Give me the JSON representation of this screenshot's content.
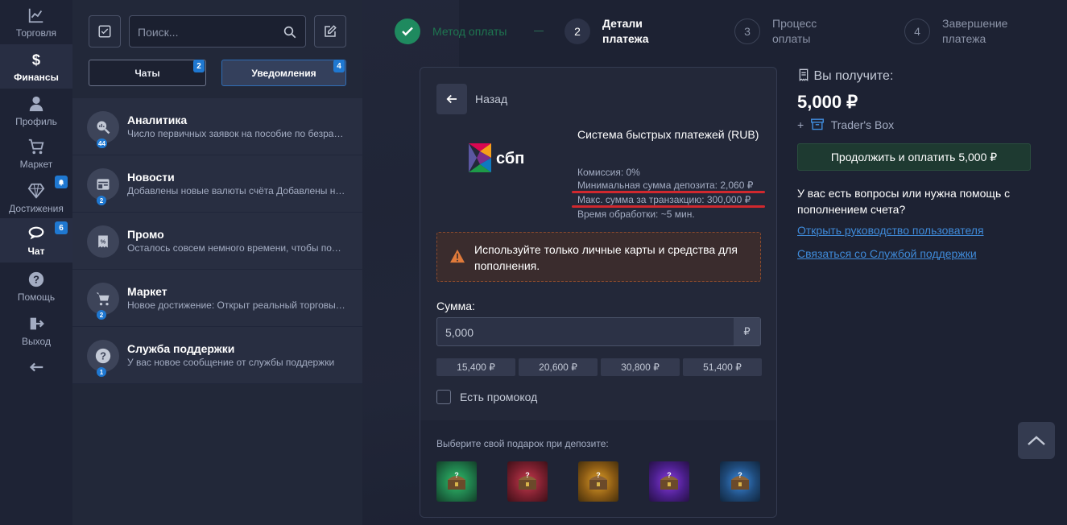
{
  "nav": {
    "items": [
      {
        "label": "Торговля",
        "icon": "chart-line-icon"
      },
      {
        "label": "Финансы",
        "icon": "dollar-icon",
        "active": true
      },
      {
        "label": "Профиль",
        "icon": "user-icon"
      },
      {
        "label": "Маркет",
        "icon": "cart-icon"
      },
      {
        "label": "Достижения",
        "icon": "diamond-icon",
        "badge_icon": "bell-icon"
      },
      {
        "label": "Чат",
        "icon": "chat-icon",
        "active": true,
        "badge": "6"
      },
      {
        "label": "Помощь",
        "icon": "question-icon"
      },
      {
        "label": "Выход",
        "icon": "logout-icon"
      }
    ],
    "collapse_icon": "arrow-left-icon"
  },
  "panel": {
    "search_placeholder": "Поиск...",
    "tabs": [
      {
        "label": "Чаты",
        "badge": "2"
      },
      {
        "label": "Уведомления",
        "badge": "4",
        "active": true
      }
    ],
    "items": [
      {
        "title": "Аналитика",
        "text": "Число первичных заявок на пособие по безработице",
        "badge": "44",
        "icon": "analytics-icon"
      },
      {
        "title": "Новости",
        "text": "Добавлены новые валюты счёта Добавлены новые",
        "badge": "2",
        "icon": "news-icon"
      },
      {
        "title": "Промо",
        "text": "Осталось совсем немного времени, чтобы получить",
        "badge": "",
        "icon": "promo-icon"
      },
      {
        "title": "Маркет",
        "text": "Новое достижение: Открыт реальный торговый счёт",
        "badge": "2",
        "icon": "cart-icon"
      },
      {
        "title": "Служба поддержки",
        "text": "У вас новое сообщение от службы поддержки",
        "badge": "1",
        "icon": "question-icon"
      }
    ]
  },
  "steps": [
    {
      "num": "",
      "label": "Метод оплаты",
      "state": "done"
    },
    {
      "num": "2",
      "label": "Детали платежа",
      "state": "active"
    },
    {
      "num": "3",
      "label": "Процесс оплаты",
      "state": "pending"
    },
    {
      "num": "4",
      "label": "Завершение платежа",
      "state": "pending"
    }
  ],
  "payment": {
    "back_label": "Назад",
    "method_name": "Система быстрых платежей (RUB)",
    "logo_text": "сбп",
    "commission": "Комиссия: 0%",
    "min_deposit": "Минимальная сумма депозита: 2,060 ₽",
    "max_tx": "Макс. сумма за транзакцию: 300,000 ₽",
    "processing": "Время обработки: ~5 мин.",
    "warning": "Используйте только личные карты и средства для пополнения.",
    "amount_label": "Сумма:",
    "amount_value": "5,000",
    "currency": "₽",
    "quick_amounts": [
      "15,400 ₽",
      "20,600 ₽",
      "30,800 ₽",
      "51,400 ₽"
    ],
    "promo_label": "Есть промокод",
    "gift_title": "Выберите свой подарок при депозите:",
    "gifts": [
      {
        "color": "#1f7a4a",
        "glow": "#2fbf6a"
      },
      {
        "color": "#7a1f2e",
        "glow": "#c83a4e"
      },
      {
        "color": "#8a5a14",
        "glow": "#e0a028"
      },
      {
        "color": "#4a1f8a",
        "glow": "#8a3ae0"
      },
      {
        "color": "#1f4a7a",
        "glow": "#3a8ae0"
      }
    ]
  },
  "summary": {
    "receive_label": "Вы получите:",
    "receive_amount": "5,000 ₽",
    "bonus": "Trader's Box",
    "continue_button": "Продолжить и оплатить 5,000 ₽",
    "help_text": "У вас есть вопросы или нужна помощь с пополнением счета?",
    "link_guide": "Открыть руководство пользователя",
    "link_support": "Связаться со Службой поддержки"
  },
  "colors": {
    "accent_blue": "#1f78d1",
    "success_green": "#1f8a5f",
    "warning_red": "#d0282e",
    "link": "#3f8ad8"
  }
}
